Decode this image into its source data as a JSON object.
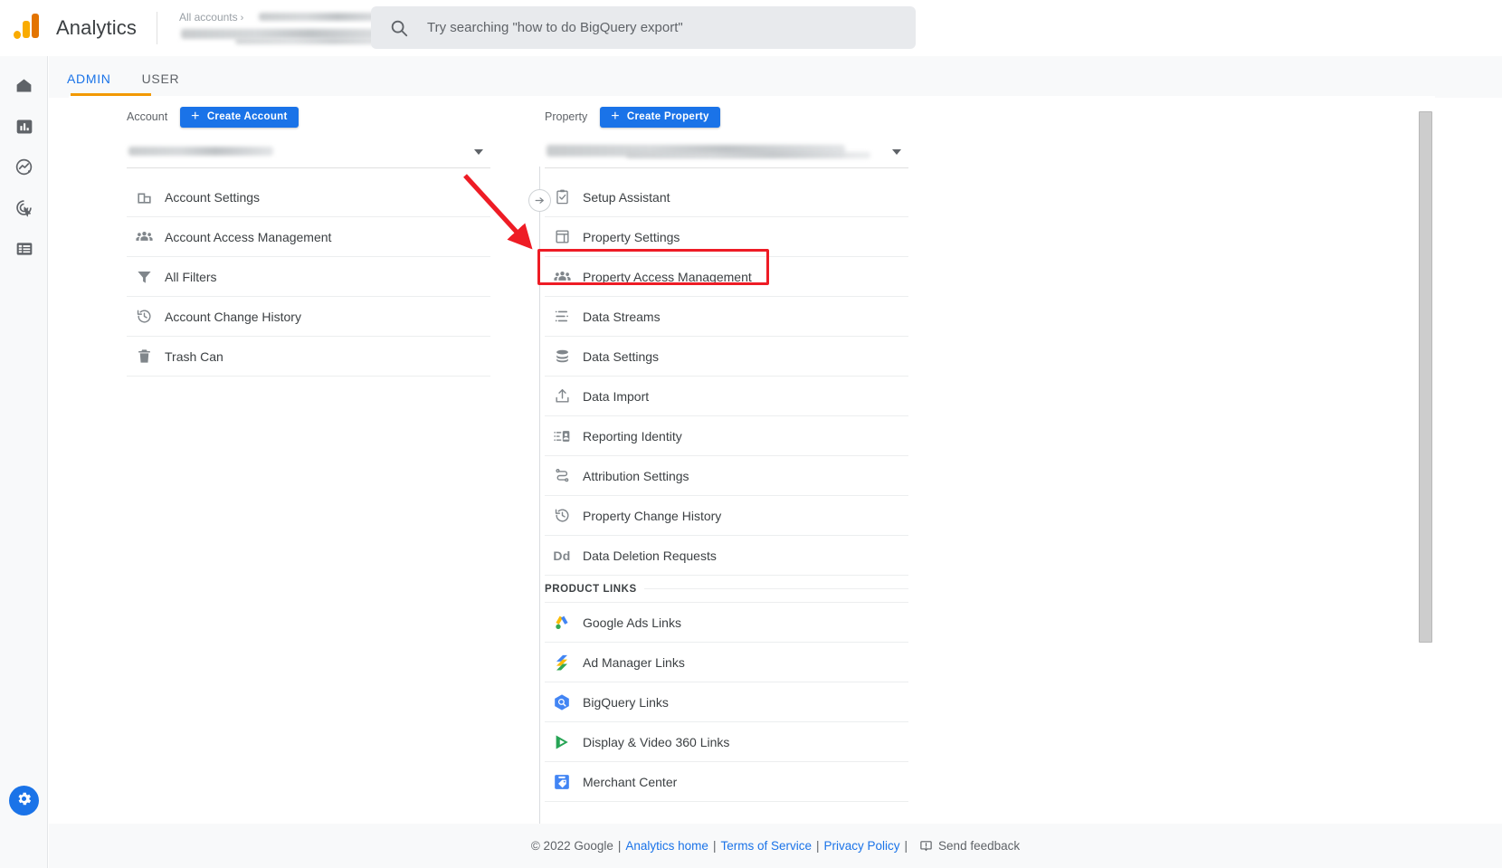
{
  "app": {
    "brand": "Analytics",
    "logo_icon": "analytics-logo-icon"
  },
  "breadcrumb": {
    "all_accounts": "All accounts",
    "separator": "›"
  },
  "search": {
    "icon": "search-icon",
    "placeholder": "Try searching \"how to do BigQuery export\"",
    "value": ""
  },
  "rail": {
    "items": [
      {
        "name": "home-icon",
        "label": "Home"
      },
      {
        "name": "reports-icon",
        "label": "Reports"
      },
      {
        "name": "explore-icon",
        "label": "Explore"
      },
      {
        "name": "advertising-icon",
        "label": "Advertising"
      },
      {
        "name": "configure-icon",
        "label": "Configure"
      }
    ],
    "gear": {
      "name": "gear-icon",
      "label": "Admin"
    }
  },
  "tabs": [
    {
      "label": "ADMIN",
      "active": true
    },
    {
      "label": "USER",
      "active": false
    }
  ],
  "account_column": {
    "label": "Account",
    "create_button": "Create Account",
    "create_icon": "plus-icon",
    "selector_caret": "chevron-down-icon",
    "items": [
      {
        "label": "Account Settings",
        "icon": "building-icon"
      },
      {
        "label": "Account Access Management",
        "icon": "people-icon"
      },
      {
        "label": "All Filters",
        "icon": "filter-icon"
      },
      {
        "label": "Account Change History",
        "icon": "history-icon"
      },
      {
        "label": "Trash Can",
        "icon": "trash-icon"
      }
    ]
  },
  "property_column": {
    "label": "Property",
    "create_button": "Create Property",
    "create_icon": "plus-icon",
    "selector_caret": "chevron-down-icon",
    "items": [
      {
        "label": "Setup Assistant",
        "icon": "clipboard-check-icon"
      },
      {
        "label": "Property Settings",
        "icon": "layout-icon"
      },
      {
        "label": "Property Access Management",
        "icon": "people-icon",
        "highlighted": true
      },
      {
        "label": "Data Streams",
        "icon": "data-streams-icon"
      },
      {
        "label": "Data Settings",
        "icon": "database-icon"
      },
      {
        "label": "Data Import",
        "icon": "upload-icon"
      },
      {
        "label": "Reporting Identity",
        "icon": "reporting-identity-icon"
      },
      {
        "label": "Attribution Settings",
        "icon": "attribution-icon"
      },
      {
        "label": "Property Change History",
        "icon": "history-icon"
      },
      {
        "label": "Data Deletion Requests",
        "icon": "dd-icon"
      }
    ],
    "product_links_header": "PRODUCT LINKS",
    "product_links": [
      {
        "label": "Google Ads Links",
        "icon": "google-ads-icon"
      },
      {
        "label": "Ad Manager Links",
        "icon": "ad-manager-icon"
      },
      {
        "label": "BigQuery Links",
        "icon": "bigquery-icon"
      },
      {
        "label": "Display & Video 360 Links",
        "icon": "display-video-360-icon"
      },
      {
        "label": "Merchant Center",
        "icon": "merchant-center-icon"
      }
    ]
  },
  "annotation": {
    "highlight_target": "Property Access Management",
    "arrow_color": "#ee1c25",
    "box_color": "#ee1c25"
  },
  "footer": {
    "copyright": "© 2022 Google",
    "links": [
      {
        "label": "Analytics home"
      },
      {
        "label": "Terms of Service"
      },
      {
        "label": "Privacy Policy"
      }
    ],
    "feedback": "Send feedback",
    "feedback_icon": "feedback-icon",
    "separator": "|"
  },
  "colors": {
    "accent_blue": "#1a73e8",
    "tab_underline_orange": "#f29900",
    "annotation_red": "#ee1c25",
    "text_primary": "#3c4043",
    "text_secondary": "#5f6368"
  }
}
